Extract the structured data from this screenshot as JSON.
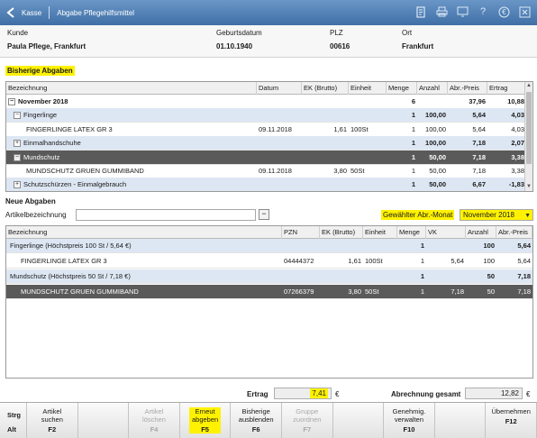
{
  "titlebar": {
    "kasse": "Kasse",
    "title": "Abgabe Pflegehilfsmittel",
    "icons": [
      "document-icon",
      "print-icon",
      "screen-icon",
      "help-icon",
      "euro-icon",
      "close-icon"
    ]
  },
  "customer": {
    "labels": {
      "kunde": "Kunde",
      "geburtsdatum": "Geburtsdatum",
      "plz": "PLZ",
      "ort": "Ort"
    },
    "values": {
      "kunde": "Paula Pflege, Frankfurt",
      "geburtsdatum": "01.10.1940",
      "plz": "00616",
      "ort": "Frankfurt"
    }
  },
  "bisherige": {
    "title": "Bisherige Abgaben",
    "columns": [
      "Bezeichnung",
      "Datum",
      "EK (Brutto)",
      "Einheit",
      "Menge",
      "Anzahl",
      "Abr.-Preis",
      "Ertrag"
    ],
    "rows": [
      {
        "kind": "month",
        "expander": "⊟",
        "bezeichnung": "November 2018",
        "datum": "",
        "ek": "",
        "einheit": "",
        "menge": "6",
        "anzahl": "",
        "preis": "37,96",
        "ertrag": "10,88"
      },
      {
        "kind": "group",
        "expander": "⊟",
        "bezeichnung": "Fingerlinge",
        "datum": "",
        "ek": "",
        "einheit": "",
        "menge": "1",
        "anzahl": "100,00",
        "preis": "5,64",
        "ertrag": "4,03"
      },
      {
        "kind": "item",
        "expander": "",
        "bezeichnung": "FINGERLINGE LATEX GR 3",
        "datum": "09.11.2018",
        "ek": "1,61",
        "einheit": "100St",
        "menge": "1",
        "anzahl": "100,00",
        "preis": "5,64",
        "ertrag": "4,03"
      },
      {
        "kind": "group",
        "expander": "⊞",
        "bezeichnung": "Einmalhandschuhe",
        "datum": "",
        "ek": "",
        "einheit": "",
        "menge": "1",
        "anzahl": "100,00",
        "preis": "7,18",
        "ertrag": "2,07"
      },
      {
        "kind": "selected",
        "expander": "⊟",
        "bezeichnung": "Mundschutz",
        "datum": "",
        "ek": "",
        "einheit": "",
        "menge": "1",
        "anzahl": "50,00",
        "preis": "7,18",
        "ertrag": "3,38"
      },
      {
        "kind": "item",
        "expander": "",
        "bezeichnung": "MUNDSCHUTZ GRUEN GUMMIBAND",
        "datum": "09.11.2018",
        "ek": "3,80",
        "einheit": "50St",
        "menge": "1",
        "anzahl": "50,00",
        "preis": "7,18",
        "ertrag": "3,38"
      },
      {
        "kind": "group",
        "expander": "⊞",
        "bezeichnung": "Schutzschürzen - Einmalgebrauch",
        "datum": "",
        "ek": "",
        "einheit": "",
        "menge": "1",
        "anzahl": "50,00",
        "preis": "6,67",
        "ertrag": "-1,83"
      }
    ]
  },
  "neue": {
    "title": "Neue Abgaben",
    "artikel_label": "Artikelbezeichnung",
    "artikel_value": "",
    "monat_label": "Gewählter Abr.-Monat",
    "monat_value": "November 2018",
    "columns": [
      "Bezeichnung",
      "PZN",
      "EK (Brutto)",
      "Einheit",
      "Menge",
      "VK",
      "Anzahl",
      "Abr.-Preis"
    ],
    "rows": [
      {
        "kind": "group",
        "bezeichnung": "Fingerlinge (Höchstpreis 100 St / 5,64 €)",
        "pzn": "",
        "ek": "",
        "einheit": "",
        "menge": "1",
        "vk": "",
        "anzahl": "100",
        "preis": "5,64"
      },
      {
        "kind": "item",
        "bezeichnung": "FINGERLINGE LATEX GR 3",
        "pzn": "04444372",
        "ek": "1,61",
        "einheit": "100St",
        "menge": "1",
        "vk": "5,64",
        "anzahl": "100",
        "preis": "5,64"
      },
      {
        "kind": "group",
        "bezeichnung": "Mundschutz (Höchstpreis 50 St / 7,18 €)",
        "pzn": "",
        "ek": "",
        "einheit": "",
        "menge": "1",
        "vk": "",
        "anzahl": "50",
        "preis": "7,18"
      },
      {
        "kind": "selected",
        "bezeichnung": "MUNDSCHUTZ GRUEN GUMMIBAND",
        "pzn": "07266379",
        "ek": "3,80",
        "einheit": "50St",
        "menge": "1",
        "vk": "7,18",
        "anzahl": "50",
        "preis": "7,18"
      }
    ]
  },
  "totals": {
    "ertrag_label": "Ertrag",
    "ertrag_value": "7,41",
    "gesamt_label": "Abrechnung gesamt",
    "gesamt_value": "12,82",
    "currency": "€"
  },
  "fkeys": {
    "strg": "Strg",
    "alt": "Alt",
    "keys": [
      {
        "line1": "Artikel",
        "line2": "suchen",
        "key": "F2",
        "disabled": false,
        "highlight": false
      },
      {
        "line1": "",
        "line2": "",
        "key": "",
        "disabled": false,
        "highlight": false
      },
      {
        "line1": "Artikel",
        "line2": "löschen",
        "key": "F4",
        "disabled": true,
        "highlight": false
      },
      {
        "line1": "Erneut",
        "line2": "abgeben",
        "key": "F5",
        "disabled": false,
        "highlight": true
      },
      {
        "line1": "Bisherige",
        "line2": "ausblenden",
        "key": "F6",
        "disabled": false,
        "highlight": false
      },
      {
        "line1": "Gruppe",
        "line2": "zuordnen",
        "key": "F7",
        "disabled": true,
        "highlight": false
      },
      {
        "line1": "",
        "line2": "",
        "key": "",
        "disabled": false,
        "highlight": false
      },
      {
        "line1": "Genehmig.",
        "line2": "verwalten",
        "key": "F10",
        "disabled": false,
        "highlight": false
      },
      {
        "line1": "",
        "line2": "",
        "key": "",
        "disabled": false,
        "highlight": false
      },
      {
        "line1": "Übernehmen",
        "line2": "",
        "key": "F12",
        "disabled": false,
        "highlight": false
      }
    ]
  },
  "colors": {
    "titlebar": "#3f6fa6",
    "highlight": "#fff200",
    "selected_row": "#5a5a5a",
    "group_row": "#dde7f3"
  }
}
